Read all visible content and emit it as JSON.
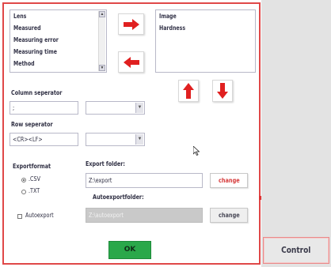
{
  "available_list": {
    "items": [
      "Lens",
      "Measured",
      "Measuring error",
      "Measuring time",
      "Method"
    ]
  },
  "selected_list": {
    "items": [
      "Image",
      "Hardness"
    ]
  },
  "column_separator": {
    "label": "Column seperator",
    "value": ";",
    "selected": ""
  },
  "row_separator": {
    "label": "Row seperator",
    "value": "<CR><LF>",
    "selected": ""
  },
  "export_format": {
    "label": "Exportformat",
    "options": [
      {
        "label": ".CSV",
        "selected": true
      },
      {
        "label": ".TXT",
        "selected": false
      }
    ]
  },
  "autoexport": {
    "label": "Autoexport",
    "checked": false
  },
  "export_folder": {
    "label": "Export folder:",
    "value": "Z:\\export",
    "change_label": "change"
  },
  "autoexport_folder": {
    "label": "Autoexportfolder:",
    "value": "Z:\\autoexport",
    "change_label": "change"
  },
  "ok_label": "OK",
  "control_label": "Control",
  "icons": {
    "move_right": "arrow-right-icon",
    "move_left": "arrow-left-icon",
    "move_up": "arrow-up-icon",
    "move_down": "arrow-down-icon",
    "cursor": "mouse-cursor-icon"
  },
  "colors": {
    "accent_red": "#e02020",
    "ok_green": "#2aa84a",
    "frame_red": "#e04848"
  }
}
